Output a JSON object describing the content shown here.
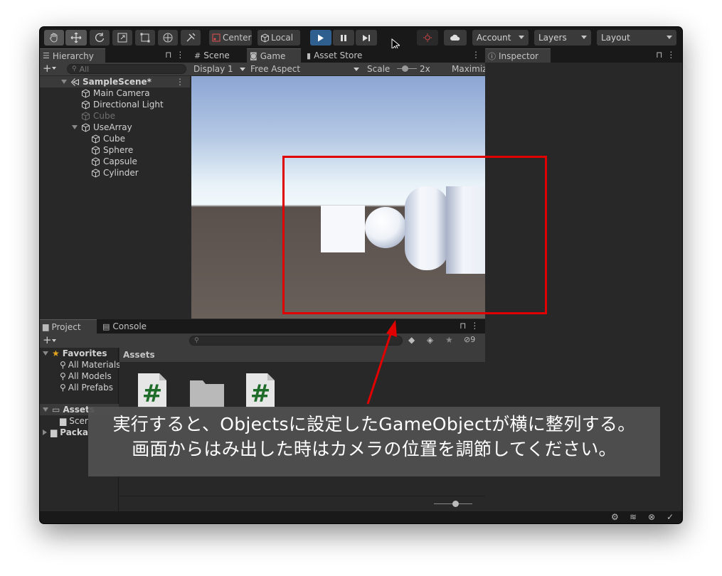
{
  "toolbar": {
    "pivot": "Center",
    "space": "Local",
    "account": "Account",
    "layers": "Layers",
    "layout": "Layout"
  },
  "hierarchy": {
    "tab": "Hierarchy",
    "search_placeholder": "All",
    "scene": "SampleScene*",
    "items": [
      {
        "label": "Main Camera",
        "indent": 1,
        "dim": false
      },
      {
        "label": "Directional Light",
        "indent": 1,
        "dim": false
      },
      {
        "label": "Cube",
        "indent": 1,
        "dim": true
      },
      {
        "label": "UseArray",
        "indent": 1,
        "dim": false
      },
      {
        "label": "Cube",
        "indent": 2,
        "dim": false
      },
      {
        "label": "Sphere",
        "indent": 2,
        "dim": false
      },
      {
        "label": "Capsule",
        "indent": 2,
        "dim": false
      },
      {
        "label": "Cylinder",
        "indent": 2,
        "dim": false
      }
    ]
  },
  "game": {
    "tabs": [
      "Scene",
      "Game",
      "Asset Store"
    ],
    "display": "Display 1",
    "aspect": "Free Aspect",
    "scale_label": "Scale",
    "scale_value": "2x",
    "maximize": "Maximiz"
  },
  "inspector": {
    "tab": "Inspector"
  },
  "project": {
    "tabs": [
      "Project",
      "Console"
    ],
    "hidden_count": "9",
    "favorites": "Favorites",
    "fav_items": [
      "All Materials",
      "All Models",
      "All Prefabs"
    ],
    "assets": "Assets",
    "scenes": "Scer",
    "packages": "Packa",
    "header": "Assets"
  },
  "caption": {
    "line1": "実行すると、Objectsに設定したGameObjectが横に整列する。",
    "line2": "画面からはみ出した時はカメラの位置を調節してください。"
  },
  "colors": {
    "annotation_red": "#e10000",
    "play_blue": "#2f5f8f"
  }
}
